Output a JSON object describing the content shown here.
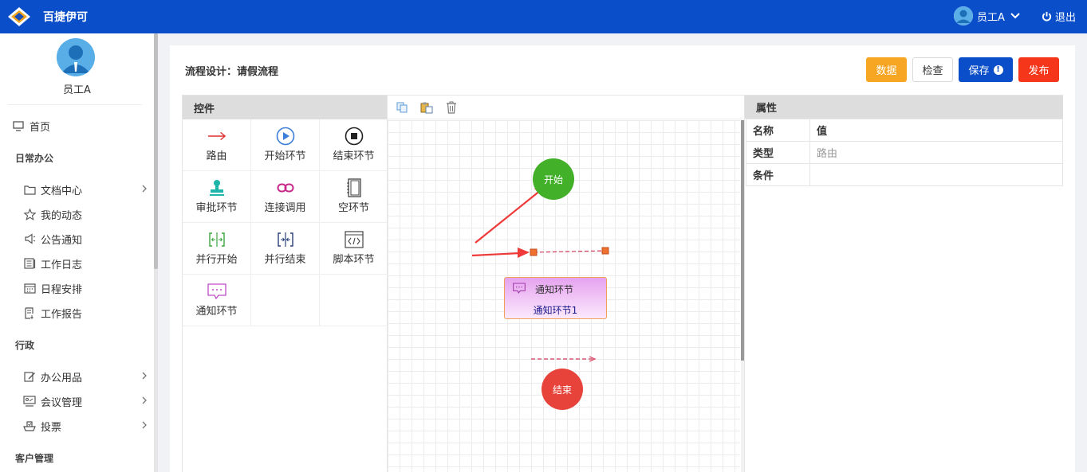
{
  "app": {
    "title": "百捷伊可"
  },
  "topbar": {
    "user_name": "员工A",
    "logout_label": "退出"
  },
  "sidebar": {
    "user_name": "员工A",
    "home": "首页",
    "groups": [
      {
        "title": "日常办公",
        "items": [
          {
            "label": "文档中心",
            "icon": "folder-icon",
            "has_arrow": true
          },
          {
            "label": "我的动态",
            "icon": "star-icon",
            "has_arrow": false
          },
          {
            "label": "公告通知",
            "icon": "speaker-icon",
            "has_arrow": false
          },
          {
            "label": "工作日志",
            "icon": "log-icon",
            "has_arrow": false
          },
          {
            "label": "日程安排",
            "icon": "calendar-icon",
            "has_arrow": false
          },
          {
            "label": "工作报告",
            "icon": "report-icon",
            "has_arrow": false
          }
        ]
      },
      {
        "title": "行政",
        "items": [
          {
            "label": "办公用品",
            "icon": "edit-icon",
            "has_arrow": true
          },
          {
            "label": "会议管理",
            "icon": "meeting-icon",
            "has_arrow": true
          },
          {
            "label": "投票",
            "icon": "vote-icon",
            "has_arrow": true
          }
        ]
      },
      {
        "title": "客户管理",
        "items": []
      }
    ]
  },
  "page": {
    "title": "流程设计：请假流程"
  },
  "toolbar": {
    "data_label": "数据",
    "check_label": "检查",
    "save_label": "保存",
    "publish_label": "发布"
  },
  "controls": {
    "header": "控件",
    "items": [
      {
        "label": "路由",
        "icon": "route-arrow-icon"
      },
      {
        "label": "开始环节",
        "icon": "play-icon"
      },
      {
        "label": "结束环节",
        "icon": "stop-icon"
      },
      {
        "label": "审批环节",
        "icon": "stamp-icon"
      },
      {
        "label": "连接调用",
        "icon": "link-icon"
      },
      {
        "label": "空环节",
        "icon": "notebook-icon"
      },
      {
        "label": "并行开始",
        "icon": "parallel-start-icon"
      },
      {
        "label": "并行结束",
        "icon": "parallel-end-icon"
      },
      {
        "label": "脚本环节",
        "icon": "code-icon"
      },
      {
        "label": "通知环节",
        "icon": "message-icon"
      }
    ]
  },
  "canvas": {
    "start_label": "开始",
    "end_label": "结束",
    "notify_node": {
      "type_label": "通知环节",
      "name": "通知环节1"
    }
  },
  "properties": {
    "header": "属性",
    "col_name": "名称",
    "col_value": "值",
    "rows": [
      {
        "key": "类型",
        "value": "路由"
      },
      {
        "key": "条件",
        "value": ""
      }
    ]
  },
  "colors": {
    "topbar": "#0a4ec9",
    "start_node": "#43b02a",
    "end_node": "#e8433a",
    "data_button": "#f6a623",
    "save_button": "#0a4ec9",
    "publish_button": "#f5361a"
  }
}
